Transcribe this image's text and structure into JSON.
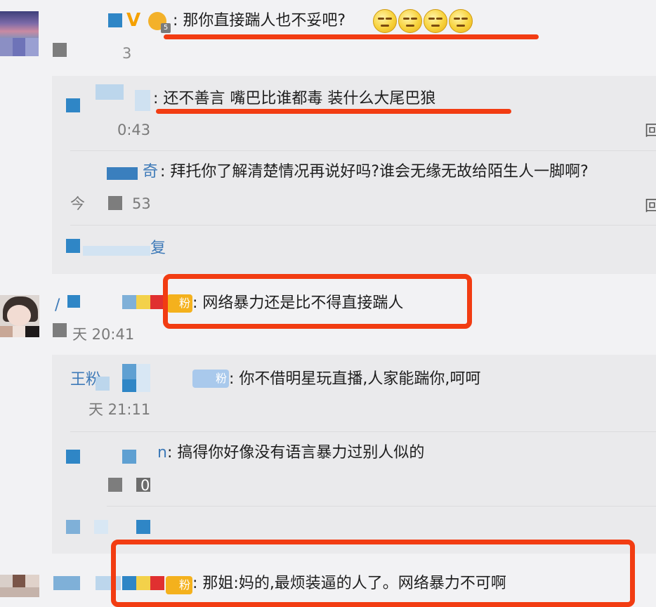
{
  "colors": {
    "annotation_red": "#f23c12",
    "badge_gold": "#f4b11d",
    "badge_blue": "#a9c9ec",
    "username_blue": "#3e7ab8",
    "mosaic_blue": "#2f86c6"
  },
  "comments": [
    {
      "name_suffix": "",
      "text": "那你直接踹人也不妥吧?",
      "emoji": "squint-laugh-emoji",
      "time_fragment": "3",
      "replies": [
        {
          "name_suffix": "",
          "text": "还不善言 嘴巴比谁都毒 装什么大尾巴狼",
          "time_fragment": "0:43",
          "reply_label": "回"
        },
        {
          "name_suffix": "奇",
          "text": "拜托你了解清楚情况再说好吗?谁会无缘无故给陌生人一脚啊?",
          "time_fragment_a": "今",
          "time_fragment_b": "53",
          "reply_label": "回"
        }
      ],
      "more_replies_fragment": "复"
    },
    {
      "name_fragment": "/",
      "badge": "粉",
      "text": "网络暴力还是比不得直接踹人",
      "time": "天 20:41",
      "replies": [
        {
          "name_fragment": "王粉",
          "badge": "粉",
          "text": "你不借明星玩直播,人家能踹你,呵呵",
          "time": "天 21:11"
        },
        {
          "name_suffix": "n",
          "text": "搞得你好像没有语言暴力过别人似的",
          "time_fragment": "0"
        }
      ]
    },
    {
      "badge": "粉",
      "text": "那姐:妈的,最烦装逼的人了。网络暴力不可啊"
    }
  ]
}
